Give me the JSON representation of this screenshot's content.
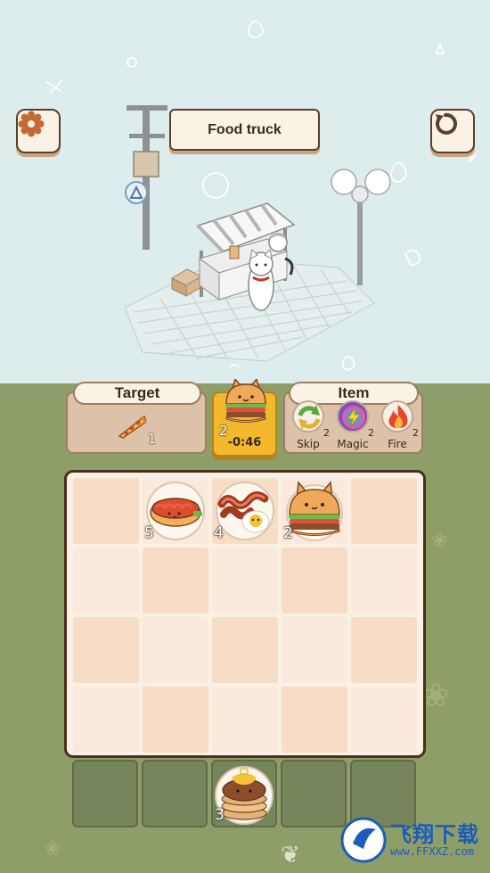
{
  "header": {
    "title": "Food truck",
    "settings_icon": "gear-icon",
    "restart_icon": "restart-icon"
  },
  "target": {
    "label": "Target",
    "food": "pizza",
    "count": "1"
  },
  "timer": {
    "food": "cat-burger",
    "count": "2",
    "time": "-0:46"
  },
  "items": {
    "label": "Item",
    "list": [
      {
        "name": "Skip",
        "count": "2",
        "icon": "skip-arrows-icon"
      },
      {
        "name": "Magic",
        "count": "2",
        "icon": "magic-bolt-icon"
      },
      {
        "name": "Fire",
        "count": "2",
        "icon": "fire-icon"
      }
    ]
  },
  "board": {
    "rows": 4,
    "cols": 5,
    "plates": [
      {
        "row": 0,
        "col": 1,
        "food": "hotdog",
        "count": "5"
      },
      {
        "row": 0,
        "col": 2,
        "food": "bacon-and-egg",
        "count": "4"
      },
      {
        "row": 0,
        "col": 3,
        "food": "cat-burger",
        "count": "2"
      }
    ]
  },
  "tray": {
    "slots": 5,
    "items": [
      {
        "slot": 2,
        "food": "pancakes",
        "count": "3"
      }
    ]
  },
  "watermark": {
    "title": "飞翔下载",
    "url": "www.FFXXZ.com"
  },
  "colors": {
    "sky": "#ddecec",
    "field": "#8e9e68",
    "board_border": "#4c2e1d",
    "timer": "#f2b92e"
  }
}
